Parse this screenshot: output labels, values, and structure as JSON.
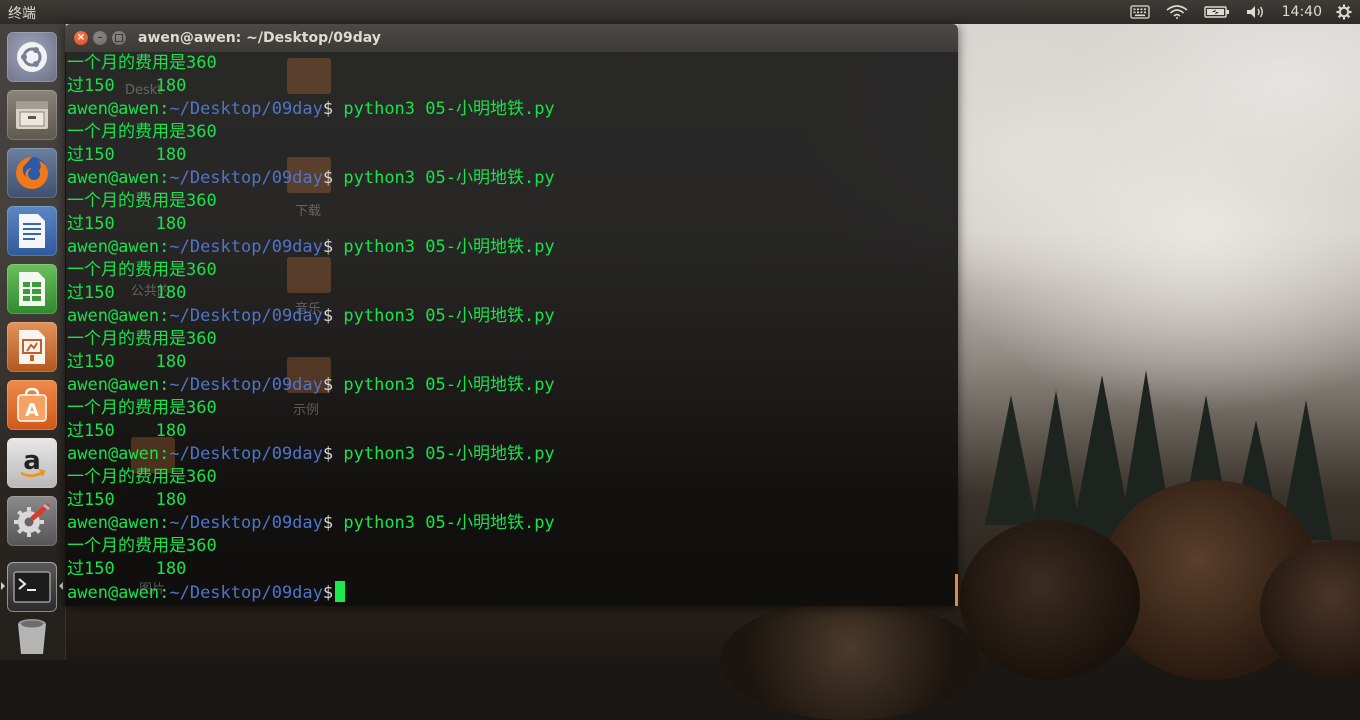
{
  "top_panel": {
    "app_title": "终端",
    "clock": "14:40",
    "icons": [
      "keyboard-icon",
      "wifi-icon",
      "battery-icon",
      "volume-icon",
      "settings-gear-icon"
    ]
  },
  "launcher": {
    "items": [
      {
        "name": "ubuntu-dash-icon"
      },
      {
        "name": "files-icon"
      },
      {
        "name": "firefox-icon"
      },
      {
        "name": "writer-icon"
      },
      {
        "name": "calc-icon"
      },
      {
        "name": "impress-icon"
      },
      {
        "name": "software-center-icon"
      },
      {
        "name": "amazon-icon"
      },
      {
        "name": "system-settings-icon"
      },
      {
        "name": "terminal-icon",
        "active": true
      },
      {
        "name": "trash-icon"
      }
    ]
  },
  "desktop_icons_faint": [
    "Deskt",
    "下载",
    "公共的",
    "音乐",
    "示例",
    "图片"
  ],
  "terminal": {
    "title": "awen@awen: ~/Desktop/09day",
    "prompt_user": "awen@awen:",
    "prompt_path": "~/Desktop/09day",
    "prompt_symbol": "$",
    "lines": [
      {
        "type": "out",
        "text": "一个月的费用是360"
      },
      {
        "type": "out",
        "text": "过150    180"
      },
      {
        "type": "cmd",
        "cmd": " python3 05-小明地铁.py"
      },
      {
        "type": "out",
        "text": "一个月的费用是360"
      },
      {
        "type": "out",
        "text": "过150    180"
      },
      {
        "type": "cmd",
        "cmd": " python3 05-小明地铁.py"
      },
      {
        "type": "out",
        "text": "一个月的费用是360"
      },
      {
        "type": "out",
        "text": "过150    180"
      },
      {
        "type": "cmd",
        "cmd": " python3 05-小明地铁.py"
      },
      {
        "type": "out",
        "text": "一个月的费用是360"
      },
      {
        "type": "out",
        "text": "过150    180"
      },
      {
        "type": "cmd",
        "cmd": " python3 05-小明地铁.py"
      },
      {
        "type": "out",
        "text": "一个月的费用是360"
      },
      {
        "type": "out",
        "text": "过150    180"
      },
      {
        "type": "cmd",
        "cmd": " python3 05-小明地铁.py"
      },
      {
        "type": "out",
        "text": "一个月的费用是360"
      },
      {
        "type": "out",
        "text": "过150    180"
      },
      {
        "type": "cmd",
        "cmd": " python3 05-小明地铁.py"
      },
      {
        "type": "out",
        "text": "一个月的费用是360"
      },
      {
        "type": "out",
        "text": "过150    180"
      },
      {
        "type": "cmd",
        "cmd": " python3 05-小明地铁.py"
      },
      {
        "type": "out",
        "text": "一个月的费用是360"
      },
      {
        "type": "out",
        "text": "过150    180"
      },
      {
        "type": "prompt",
        "cmd": " "
      }
    ]
  }
}
